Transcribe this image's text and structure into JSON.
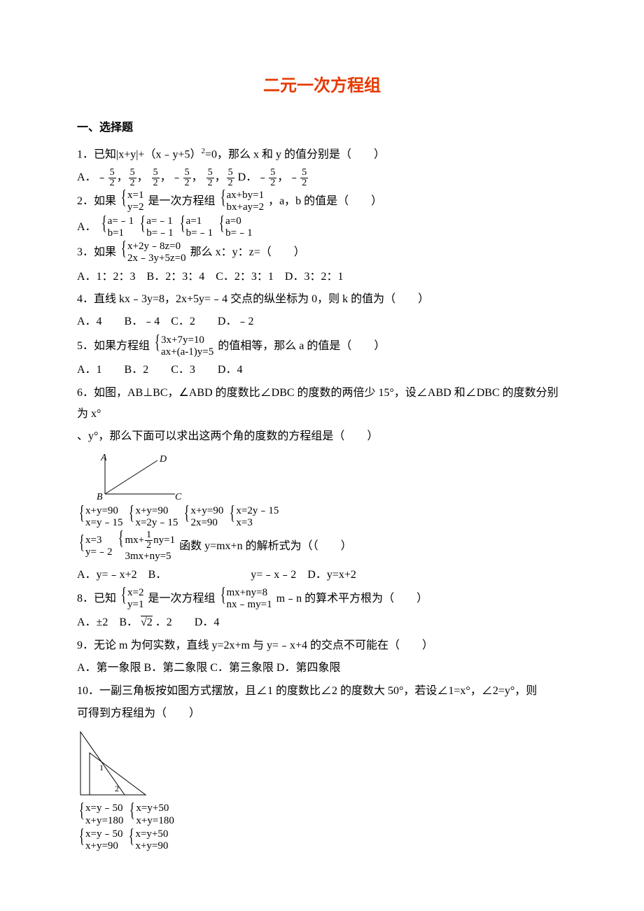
{
  "title": "二元一次方程组",
  "section1": "一、选择题",
  "q1": {
    "stem_a": "1．已知|x+y|+（x﹣y+5）",
    "stem_b": "=0，那么 x 和 y 的值分别是（　　）",
    "A_pre": "A．",
    "A_mid": "，",
    "B_mid": "，﹣",
    "C_mid": "，",
    "D_pre": " D．﹣",
    "D_mid": "，﹣",
    "n": "5",
    "d": "2"
  },
  "q2": {
    "stem_a": "2．如果",
    "sys1_a": "x=1",
    "sys1_b": "y=2",
    "stem_b": "是一次方程组",
    "sys2_a": "ax+by=1",
    "sys2_b": "bx+ay=2",
    "stem_c": "，a，b 的值是（　　）",
    "A": "A．",
    "aA1": "a=﹣1",
    "aA2": "b=1",
    "aB1": "a=﹣1",
    "aB2": "b=﹣1",
    "aC1": "a=1",
    "aC2": "b=﹣1",
    "aD1": "a=0",
    "aD2": "b=﹣1"
  },
  "q3": {
    "stem_a": "3．如果",
    "sys_a": "x+2y﹣8z=0",
    "sys_b": "2x﹣3y+5z=0",
    "stem_b": "那么 x：y：z=（　　）",
    "opts": "A．1：2：3　B．2：3：4　C．2：3：1　D．3：2：1"
  },
  "q4": {
    "stem": "4．直线 kx﹣3y=8，2x+5y=﹣4 交点的纵坐标为 0，则 k 的值为（　　）",
    "opts": "A．4　　B．﹣4　C．2　　D．﹣2"
  },
  "q5": {
    "stem_a": "5．如果方程组",
    "sys_a": "3x+7y=10",
    "sys_b": "ax+(a-1)y=5",
    "stem_b": "的值相等，那么 a 的值是（　　）",
    "opts": "A．1　　B．2　　C．3　　D．4"
  },
  "q6": {
    "stem1": "6．如图，AB⊥BC，∠ABD 的度数比∠DBC 的度数的两倍少 15°，设∠ABD 和∠DBC 的度数分别为 x°",
    "stem2": "、y°，那么下面可以求出这两个角的度数的方程组是（　　）",
    "labelA": "A",
    "labelD": "D",
    "labelB": "B",
    "labelC": "C",
    "a1": "x+y=90",
    "a2": "x=y﹣15",
    "b1": "x+y=90",
    "b2": "x=2y﹣15",
    "c1": "x+y=90",
    "c2": "2x=90",
    "d1": "x=2y﹣15",
    "d2": "x=3"
  },
  "q7": {
    "pre": "7．",
    "sys1_a": "x=3",
    "sys1_b": "y=﹣2",
    "mid": "是",
    "sys2_a": "mx+",
    "half_n": "1",
    "half_d": "2",
    "sys2_a2": "ny=1",
    "sys2_b": "3mx+ny=5",
    "stem_b": "函数 y=mx+n 的解析式为（（　　）",
    "opts": "A．y=﹣x+2　B．　　　　　　　　y=﹣x﹣2　D．y=x+2"
  },
  "q8": {
    "stem_a": "8．已知",
    "sys1_a": "x=2",
    "sys1_b": "y=1",
    "stem_b": "是一次方程组",
    "sys2_a": "mx+ny=8",
    "sys2_b": "nx﹣my=1",
    "stem_c": "m﹣n 的算术平方根为（　　）",
    "opts_a": "A．±2　B．",
    "rad": "√2",
    "opts_b": "．2　　D．4"
  },
  "q9": {
    "stem": "9．无论 m 为何实数，直线 y=2x+m 与 y=﹣x+4 的交点不可能在（　　）",
    "opts": "A．第一象限 B．第二象限 C．第三象限 D．第四象限"
  },
  "q10": {
    "stem1": "10．一副三角板按如图方式摆放，且∠1 的度数比∠2 的度数大 50°，若设∠1=x°，∠2=y°，则",
    "stem2": "可得到方程组为（　　）",
    "a1": "x=y﹣50",
    "a2": "x+y=180",
    "b1": "x=y+50",
    "b2": "x+y=180",
    "c1": "x=y﹣50",
    "c2": "x+y=90",
    "d1": "x=y+50",
    "d2": "x+y=90"
  }
}
